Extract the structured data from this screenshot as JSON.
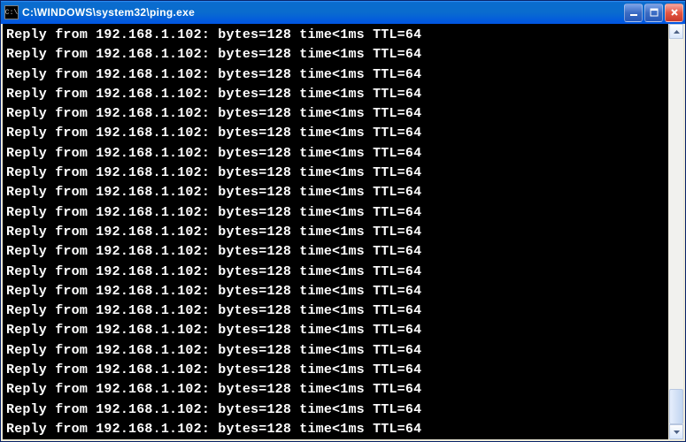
{
  "titlebar": {
    "icon_label": "C:\\",
    "title": "C:\\WINDOWS\\system32\\ping.exe"
  },
  "console": {
    "ip": "192.168.1.102",
    "bytes": "128",
    "time": "<1ms",
    "ttl": "64",
    "line_template": "Reply from {ip}: bytes={bytes} time{time} TTL={ttl}",
    "lines": [
      "Reply from 192.168.1.102: bytes=128 time<1ms TTL=64",
      "Reply from 192.168.1.102: bytes=128 time<1ms TTL=64",
      "Reply from 192.168.1.102: bytes=128 time<1ms TTL=64",
      "Reply from 192.168.1.102: bytes=128 time<1ms TTL=64",
      "Reply from 192.168.1.102: bytes=128 time<1ms TTL=64",
      "Reply from 192.168.1.102: bytes=128 time<1ms TTL=64",
      "Reply from 192.168.1.102: bytes=128 time<1ms TTL=64",
      "Reply from 192.168.1.102: bytes=128 time<1ms TTL=64",
      "Reply from 192.168.1.102: bytes=128 time<1ms TTL=64",
      "Reply from 192.168.1.102: bytes=128 time<1ms TTL=64",
      "Reply from 192.168.1.102: bytes=128 time<1ms TTL=64",
      "Reply from 192.168.1.102: bytes=128 time<1ms TTL=64",
      "Reply from 192.168.1.102: bytes=128 time<1ms TTL=64",
      "Reply from 192.168.1.102: bytes=128 time<1ms TTL=64",
      "Reply from 192.168.1.102: bytes=128 time<1ms TTL=64",
      "Reply from 192.168.1.102: bytes=128 time<1ms TTL=64",
      "Reply from 192.168.1.102: bytes=128 time<1ms TTL=64",
      "Reply from 192.168.1.102: bytes=128 time<1ms TTL=64",
      "Reply from 192.168.1.102: bytes=128 time<1ms TTL=64",
      "Reply from 192.168.1.102: bytes=128 time<1ms TTL=64",
      "Reply from 192.168.1.102: bytes=128 time<1ms TTL=64"
    ]
  }
}
